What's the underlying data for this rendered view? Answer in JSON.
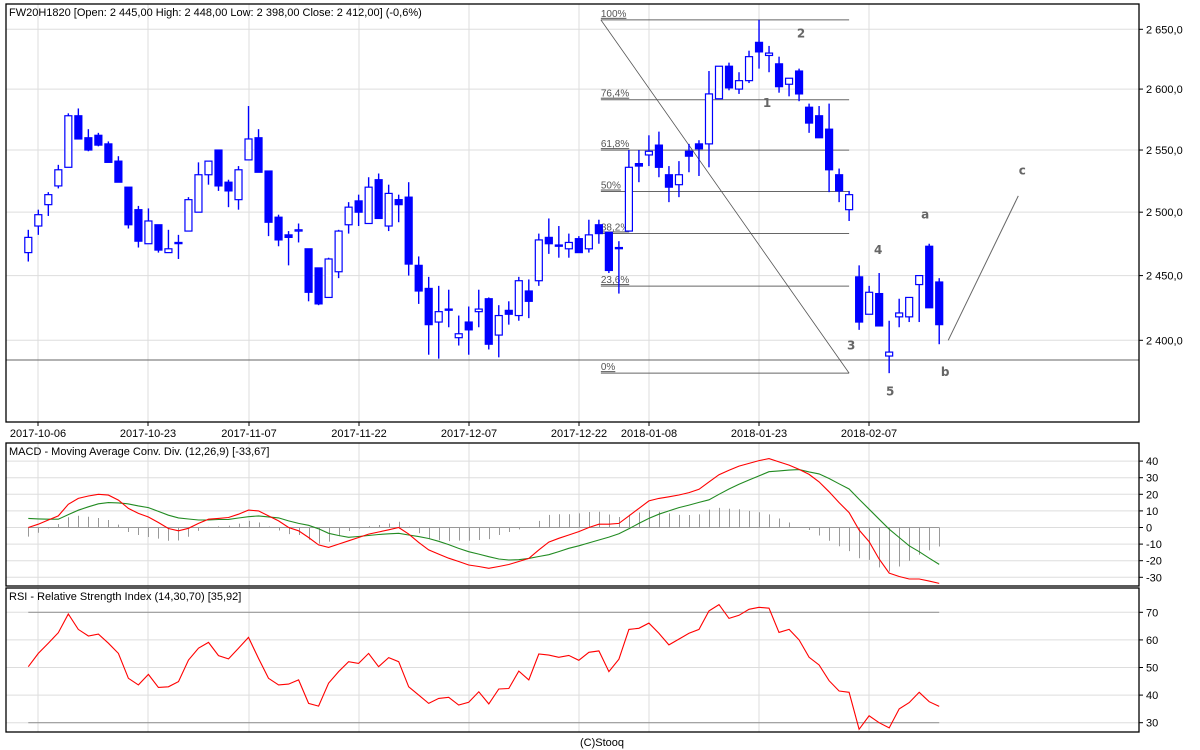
{
  "header": {
    "title": "FW20H1820 [Open: 2 445,00  High: 2 448,00  Low: 2 398,00  Close: 2 412,00] (-0,6%)",
    "footer": "(C)Stooq"
  },
  "colors": {
    "candle": "#0000ff",
    "macd": "#ff0000",
    "signal": "#228b22",
    "histogram": "#999999",
    "rsi": "#ff0000",
    "grid": "#dddddd",
    "annot": "#666666"
  },
  "chart_data": [
    {
      "type": "candlestick",
      "symbol": "FW20H1820",
      "price_ticks": [
        2650,
        2600,
        2550,
        2500,
        2450,
        2400
      ],
      "price_tick_labels": [
        "2 650,0",
        "2 600,0",
        "2 550,0",
        "2 500,0",
        "2 450,0",
        "2 400,0"
      ],
      "date_ticks": [
        {
          "index": 1,
          "label": "2017-10-06"
        },
        {
          "index": 12,
          "label": "2017-10-23"
        },
        {
          "index": 22,
          "label": "2017-11-07"
        },
        {
          "index": 33,
          "label": "2017-11-22"
        },
        {
          "index": 44,
          "label": "2017-12-07"
        },
        {
          "index": 55,
          "label": "2017-12-22"
        },
        {
          "index": 62,
          "label": "2018-01-08"
        },
        {
          "index": 73,
          "label": "2018-01-23"
        },
        {
          "index": 84,
          "label": "2018-02-07"
        }
      ],
      "ohlc": [
        [
          2468,
          2486,
          2461,
          2480
        ],
        [
          2489,
          2502,
          2482,
          2498
        ],
        [
          2506,
          2516,
          2497,
          2514
        ],
        [
          2521,
          2538,
          2519,
          2534
        ],
        [
          2536,
          2580,
          2536,
          2578
        ],
        [
          2578,
          2584,
          2559,
          2559
        ],
        [
          2560,
          2567,
          2549,
          2550
        ],
        [
          2562,
          2564,
          2553,
          2554
        ],
        [
          2555,
          2557,
          2540,
          2540
        ],
        [
          2541,
          2545,
          2524,
          2524
        ],
        [
          2520,
          2520,
          2487,
          2490
        ],
        [
          2502,
          2505,
          2472,
          2477
        ],
        [
          2475,
          2503,
          2475,
          2493
        ],
        [
          2490,
          2490,
          2468,
          2470
        ],
        [
          2468,
          2486,
          2468,
          2471
        ],
        [
          2476,
          2482,
          2463,
          2476
        ],
        [
          2485,
          2512,
          2485,
          2510
        ],
        [
          2500,
          2540,
          2500,
          2530
        ],
        [
          2530,
          2541,
          2522,
          2541
        ],
        [
          2550,
          2550,
          2517,
          2521
        ],
        [
          2524,
          2526,
          2504,
          2517
        ],
        [
          2510,
          2537,
          2502,
          2534
        ],
        [
          2542,
          2586,
          2542,
          2559
        ],
        [
          2560,
          2567,
          2532,
          2532
        ],
        [
          2533,
          2533,
          2481,
          2492
        ],
        [
          2496,
          2498,
          2473,
          2478
        ],
        [
          2482,
          2485,
          2458,
          2480
        ],
        [
          2485,
          2491,
          2476,
          2486
        ],
        [
          2471,
          2471,
          2430,
          2437
        ],
        [
          2456,
          2456,
          2427,
          2428
        ],
        [
          2433,
          2464,
          2433,
          2463
        ],
        [
          2453,
          2486,
          2448,
          2485
        ],
        [
          2490,
          2508,
          2483,
          2504
        ],
        [
          2509,
          2514,
          2489,
          2500
        ],
        [
          2491,
          2528,
          2491,
          2520
        ],
        [
          2526,
          2531,
          2495,
          2495
        ],
        [
          2489,
          2522,
          2485,
          2515
        ],
        [
          2510,
          2514,
          2492,
          2506
        ],
        [
          2512,
          2524,
          2450,
          2459
        ],
        [
          2458,
          2465,
          2428,
          2438
        ],
        [
          2440,
          2449,
          2389,
          2412
        ],
        [
          2414,
          2442,
          2386,
          2422
        ],
        [
          2424,
          2439,
          2410,
          2424
        ],
        [
          2402,
          2419,
          2396,
          2405
        ],
        [
          2414,
          2426,
          2389,
          2408
        ],
        [
          2422,
          2439,
          2410,
          2424
        ],
        [
          2432,
          2433,
          2393,
          2397
        ],
        [
          2404,
          2427,
          2387,
          2419
        ],
        [
          2423,
          2430,
          2412,
          2420
        ],
        [
          2419,
          2449,
          2415,
          2446
        ],
        [
          2438,
          2447,
          2417,
          2430
        ],
        [
          2446,
          2483,
          2442,
          2478
        ],
        [
          2480,
          2495,
          2467,
          2475
        ],
        [
          2474,
          2489,
          2464,
          2473
        ],
        [
          2471,
          2483,
          2464,
          2476
        ],
        [
          2479,
          2481,
          2468,
          2468
        ],
        [
          2471,
          2494,
          2468,
          2482
        ],
        [
          2490,
          2494,
          2475,
          2483
        ],
        [
          2484,
          2484,
          2452,
          2454
        ],
        [
          2472,
          2477,
          2436,
          2472
        ],
        [
          2485,
          2550,
          2485,
          2536
        ],
        [
          2539,
          2550,
          2524,
          2537
        ],
        [
          2546,
          2562,
          2537,
          2549
        ],
        [
          2554,
          2565,
          2528,
          2536
        ],
        [
          2530,
          2537,
          2508,
          2520
        ],
        [
          2522,
          2541,
          2512,
          2530
        ],
        [
          2549,
          2555,
          2532,
          2545
        ],
        [
          2555,
          2558,
          2529,
          2551
        ],
        [
          2555,
          2615,
          2536,
          2596
        ],
        [
          2592,
          2619,
          2592,
          2619
        ],
        [
          2619,
          2622,
          2599,
          2601
        ],
        [
          2600,
          2614,
          2596,
          2607
        ],
        [
          2607,
          2632,
          2605,
          2627
        ],
        [
          2639,
          2658,
          2617,
          2631
        ],
        [
          2628,
          2636,
          2614,
          2630
        ],
        [
          2621,
          2627,
          2597,
          2602
        ],
        [
          2604,
          2609,
          2594,
          2609
        ],
        [
          2615,
          2617,
          2590,
          2596
        ],
        [
          2585,
          2588,
          2564,
          2572
        ],
        [
          2578,
          2586,
          2560,
          2560
        ],
        [
          2567,
          2588,
          2516,
          2534
        ],
        [
          2530,
          2535,
          2508,
          2517
        ],
        [
          2502,
          2517,
          2493,
          2514
        ],
        [
          2449,
          2458,
          2408,
          2414
        ],
        [
          2420,
          2442,
          2420,
          2437
        ],
        [
          2436,
          2452,
          2411,
          2411
        ],
        [
          2388,
          2415,
          2375,
          2391
        ],
        [
          2418,
          2432,
          2410,
          2421
        ],
        [
          2418,
          2433,
          2414,
          2433
        ],
        [
          2443,
          2450,
          2414,
          2450
        ],
        [
          2473,
          2475,
          2425,
          2425
        ],
        [
          2445,
          2448,
          2397,
          2412
        ]
      ],
      "support_level": 2385,
      "fibonacci": {
        "high": 2658,
        "low": 2375,
        "start_index": 57.2,
        "end_index": 82,
        "levels": [
          {
            "ratio": 1.0,
            "label": "100%"
          },
          {
            "ratio": 0.764,
            "label": "76,4%"
          },
          {
            "ratio": 0.618,
            "label": "61,8%"
          },
          {
            "ratio": 0.5,
            "label": "50%"
          },
          {
            "ratio": 0.382,
            "label": "38,2%"
          },
          {
            "ratio": 0.236,
            "label": "23,6%"
          },
          {
            "ratio": 0.0,
            "label": "0%"
          }
        ]
      },
      "wave_labels": [
        {
          "text": "1",
          "index": 73.8,
          "price": 2585
        },
        {
          "text": "2",
          "index": 77.2,
          "price": 2643
        },
        {
          "text": "3",
          "index": 82.2,
          "price": 2393
        },
        {
          "text": "4",
          "index": 84.9,
          "price": 2467
        },
        {
          "text": "5",
          "index": 86.1,
          "price": 2358
        },
        {
          "text": "a",
          "index": 89.6,
          "price": 2495
        },
        {
          "text": "b",
          "index": 91.6,
          "price": 2373
        },
        {
          "text": "c",
          "index": 99.3,
          "price": 2530
        }
      ],
      "projection_line": {
        "from": {
          "index": 91.9,
          "price": 2400
        },
        "to": {
          "index": 98.9,
          "price": 2513
        }
      }
    },
    {
      "type": "line",
      "title": "MACD - Moving Average Conv. Div. (12,26,9) [-33,67]",
      "ticks": [
        40,
        30,
        20,
        10,
        0,
        -10,
        -20,
        -30
      ],
      "macd": [
        0,
        2,
        4.5,
        7,
        14,
        17.5,
        19,
        20,
        19.5,
        16.5,
        11.5,
        8.5,
        6.3,
        3,
        -0.6,
        -2,
        -0.5,
        2.5,
        5,
        5.5,
        6,
        8,
        10.5,
        10,
        7,
        4,
        0,
        -2,
        -6,
        -10.5,
        -12,
        -10,
        -8,
        -6,
        -4,
        -2.7,
        -1.4,
        0,
        -4,
        -9,
        -13.5,
        -16,
        -18.5,
        -20.5,
        -22.6,
        -23.5,
        -24.6,
        -23.5,
        -22.3,
        -20.5,
        -18.6,
        -13.5,
        -8.8,
        -6.5,
        -4.5,
        -2.5,
        0,
        2,
        2,
        2.5,
        7,
        11.5,
        16,
        17.5,
        18.5,
        19.6,
        21,
        23,
        27.5,
        31.8,
        34.5,
        37,
        38.6,
        40.3,
        41.5,
        39.5,
        37.6,
        35,
        32,
        27.5,
        21.5,
        15,
        9,
        -1.5,
        -8.5,
        -19,
        -27.5,
        -29.5,
        -31,
        -31,
        -32.3,
        -33.67
      ],
      "signal": [
        5.5,
        5.2,
        5,
        5,
        7.8,
        10.4,
        12.5,
        14.3,
        15,
        14.8,
        14.2,
        13,
        12,
        9.7,
        7.4,
        5.8,
        5.1,
        4.5,
        4.6,
        4.8,
        4.9,
        5.7,
        6.5,
        7,
        6.4,
        5.8,
        4,
        2.5,
        1.3,
        -0.8,
        -3.5,
        -4.8,
        -5.9,
        -5.4,
        -4.8,
        -4.2,
        -3.8,
        -3.5,
        -4.5,
        -5.5,
        -6.6,
        -8.3,
        -10.3,
        -12.6,
        -14.6,
        -16,
        -17.6,
        -19,
        -19.6,
        -19.4,
        -18.6,
        -17.5,
        -16.4,
        -14.5,
        -12.5,
        -11,
        -9.3,
        -7.5,
        -5.8,
        -3.8,
        -0.7,
        2.5,
        5.5,
        8,
        10,
        12,
        13.5,
        15.1,
        16.7,
        20,
        23.2,
        26,
        28.6,
        31.1,
        33.6,
        34.1,
        34.6,
        34.9,
        33.5,
        32.3,
        29.5,
        26.3,
        23.2,
        17,
        11,
        5,
        -1,
        -6,
        -11,
        -14.6,
        -18.5,
        -22.2
      ]
    },
    {
      "type": "line",
      "title": "RSI - Relative Strength Index (14,30,70) [35,92]",
      "ticks": [
        70,
        60,
        50,
        40,
        30
      ],
      "bands": [
        70,
        30
      ],
      "rsi": [
        50.3,
        55.1,
        58.8,
        62.6,
        69.4,
        63.8,
        61.4,
        62.1,
        58.8,
        55.1,
        46.1,
        43.7,
        47.5,
        42.8,
        43,
        44.9,
        52.7,
        57,
        59.1,
        54.3,
        53.1,
        57,
        60.9,
        53.3,
        46.1,
        43.7,
        44,
        45.5,
        37,
        36,
        44.3,
        48.5,
        52.1,
        51.5,
        55.1,
        50.3,
        53.6,
        52.1,
        43,
        40,
        37,
        38.8,
        39.2,
        36.4,
        37.4,
        41.2,
        36.8,
        42.2,
        42.4,
        48.7,
        45.5,
        54.9,
        54.5,
        53.7,
        54.4,
        52.6,
        55.5,
        56,
        48.5,
        53,
        63.8,
        64.2,
        66.1,
        62.4,
        58.2,
        60.3,
        62.4,
        63.8,
        70.5,
        72.8,
        67.8,
        68.9,
        71.1,
        71.8,
        71.5,
        62.7,
        63.8,
        60,
        53.7,
        50.9,
        45.2,
        41.5,
        41,
        27.6,
        32.5,
        30,
        28.1,
        35,
        37.3,
        41,
        37.6,
        35.92
      ]
    }
  ]
}
